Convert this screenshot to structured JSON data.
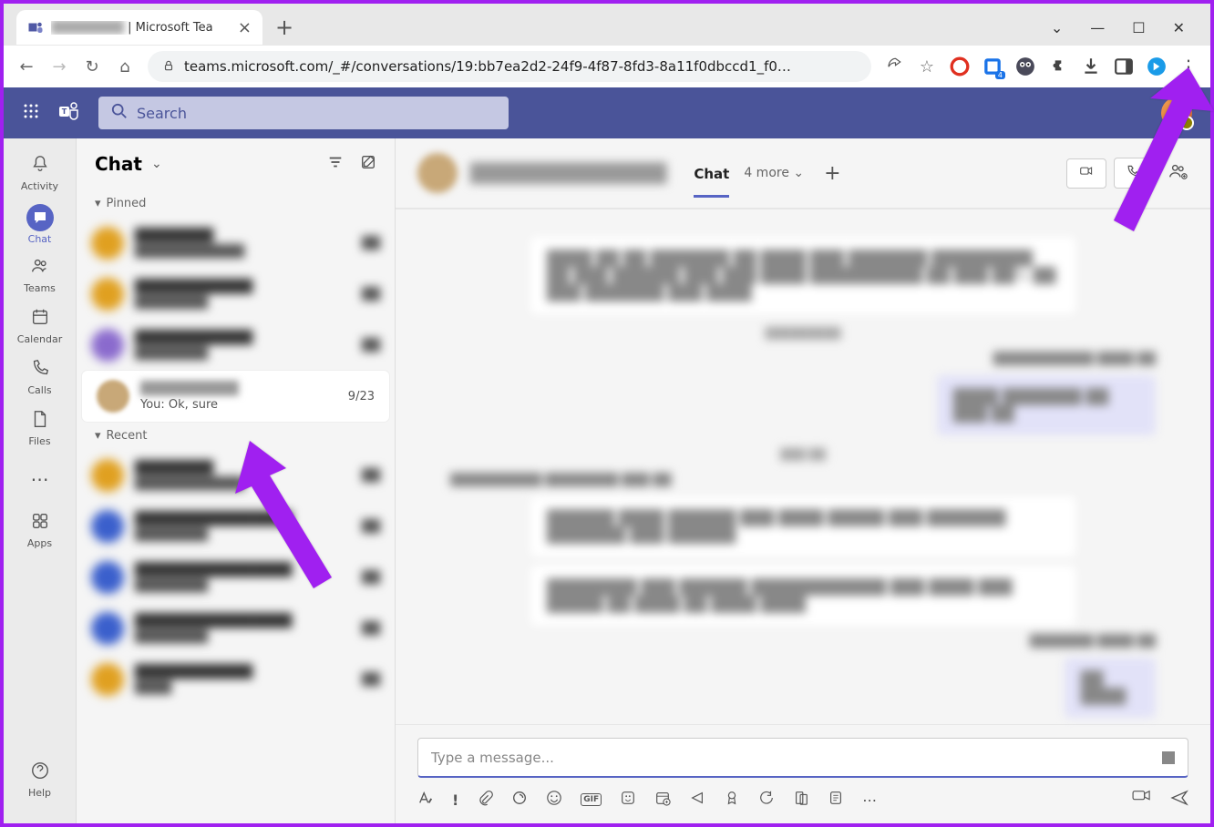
{
  "browser": {
    "tab_title_suffix": " | Microsoft Tea",
    "url": "teams.microsoft.com/_#/conversations/19:bb7ea2d2-24f9-4f87-8fd3-8a11f0dbccd1_f0…"
  },
  "teams": {
    "search_placeholder": "Search"
  },
  "rail": {
    "activity": "Activity",
    "chat": "Chat",
    "teams": "Teams",
    "calendar": "Calendar",
    "calls": "Calls",
    "files": "Files",
    "apps": "Apps",
    "help": "Help"
  },
  "chat": {
    "title": "Chat",
    "pinned_label": "Pinned",
    "recent_label": "Recent",
    "selected": {
      "date": "9/23",
      "preview": "You: Ok, sure"
    }
  },
  "convo": {
    "tab_chat": "Chat",
    "tab_more": "4 more",
    "compose_placeholder": "Type a message...",
    "icons": {
      "format": "Aᵨ",
      "important": "!",
      "attach": "📎",
      "loop": "◉",
      "emoji": "☺",
      "gif": "GIF",
      "sticker": "☺",
      "schedule": "⧉",
      "approve": "▷",
      "praise": "◉",
      "stream": "↻",
      "copy": "⧉",
      "poll": "☰",
      "more": "…",
      "cam": "▭►",
      "send": "➢"
    }
  }
}
